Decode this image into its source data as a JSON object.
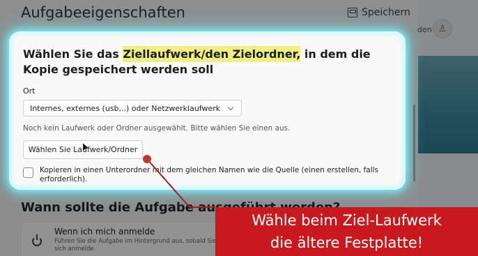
{
  "app": {
    "title": "Aufgabeeigenschaften",
    "save_label": "Speichern",
    "right_label": "den",
    "avatar_glyph": "♙"
  },
  "panel": {
    "heading_part1": "Wählen Sie das ",
    "heading_highlight": "Ziellaufwerk/den Zielordner,",
    "heading_part2": " in dem die Kopie gespeichert werden soll",
    "location_label": "Ort",
    "location_value": "Internes, externes (usb,..) oder Netzwerklaufwerk",
    "status_text": "Noch kein Laufwerk oder Ordner ausgewählt. Bitte wählen Sie einen aus.",
    "choose_button": "Wählen Sie Laufwerk/Ordner",
    "checkbox_label": "Kopieren in einen Unterordner mit dem gleichen Namen wie die Quelle (einen erstellen, falls erforderlich).",
    "checkbox_checked": false
  },
  "section2": {
    "title": "Wann sollte die Aufgabe ausgeführt werden?",
    "option_title": "Wenn ich mich anmelde",
    "option_desc": "Führen Sie die Aufgabe im Hintergrund aus, sobald Sie sich anmelde."
  },
  "callout": {
    "line1": "Wähle beim Ziel-Laufwerk",
    "line2": "die ältere Festplatte!"
  },
  "colors": {
    "highlight": "#efee85",
    "glow": "#7feaf5",
    "callout_bg": "#c8191e",
    "arrow": "#a02020"
  },
  "icons": {
    "save": "save-icon",
    "avatar": "person-icon",
    "power": "power-icon",
    "cursor": "mouse-cursor-icon",
    "chevron": "chevron-down-icon"
  }
}
